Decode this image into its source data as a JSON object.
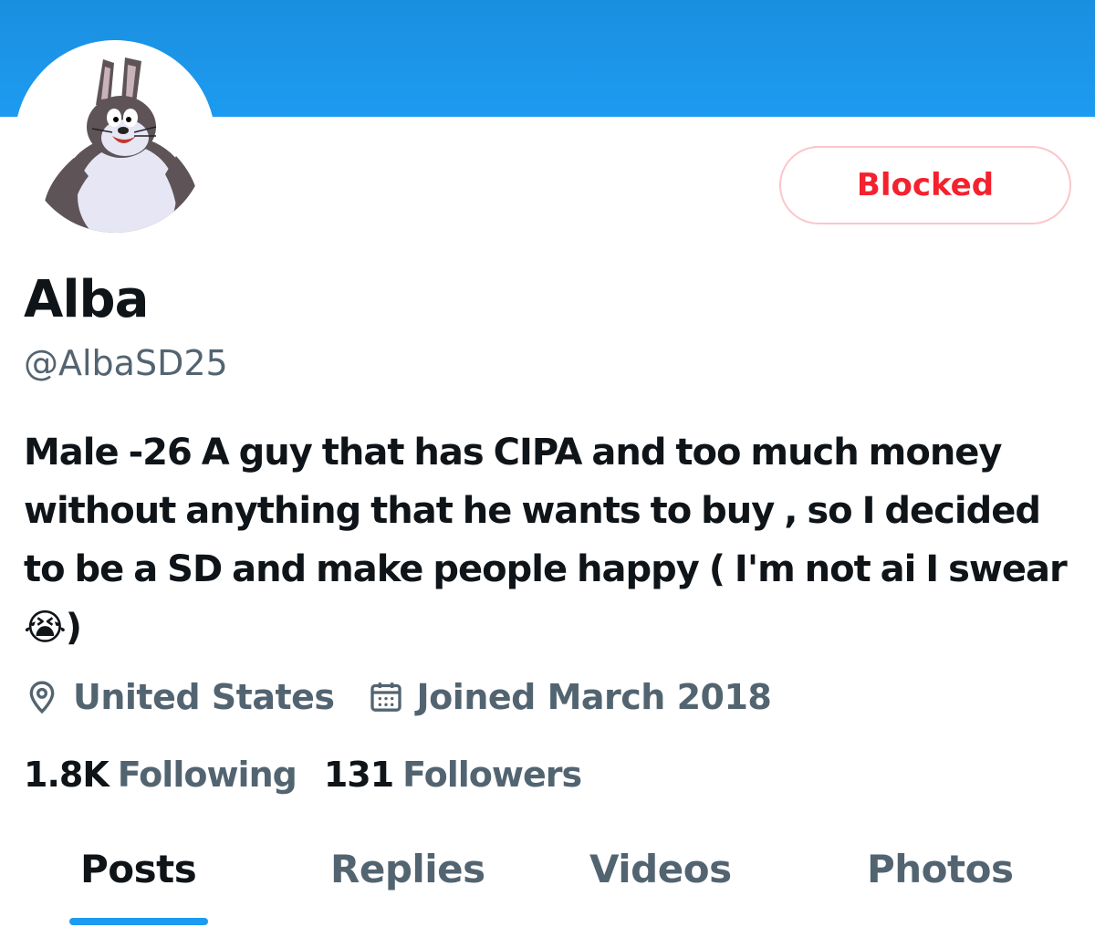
{
  "profile": {
    "display_name": "Alba",
    "handle": "@AlbaSD25",
    "avatar_icon": "cartoon-chungus-avatar",
    "bio": "Male -26 A guy that has CIPA and too much money without anything that he wants to buy , so I decided to be a SD and make people happy ( I'm not ai I swear 😭)",
    "location": "United States",
    "joined": "Joined March 2018",
    "following_count": "1.8K",
    "following_label": "Following",
    "followers_count": "131",
    "followers_label": "Followers"
  },
  "actions": {
    "blocked_label": "Blocked"
  },
  "icons": {
    "location": "location-pin-icon",
    "joined": "calendar-icon"
  },
  "tabs": [
    {
      "label": "Posts",
      "active": true
    },
    {
      "label": "Replies",
      "active": false
    },
    {
      "label": "Videos",
      "active": false
    },
    {
      "label": "Photos",
      "active": false
    }
  ],
  "colors": {
    "banner": "#1d9bf0",
    "blocked_text": "#f4212e",
    "blocked_border": "#fac6ca",
    "secondary_text": "#536471",
    "primary_text": "#0f1419",
    "tab_indicator": "#1d9bf0"
  }
}
